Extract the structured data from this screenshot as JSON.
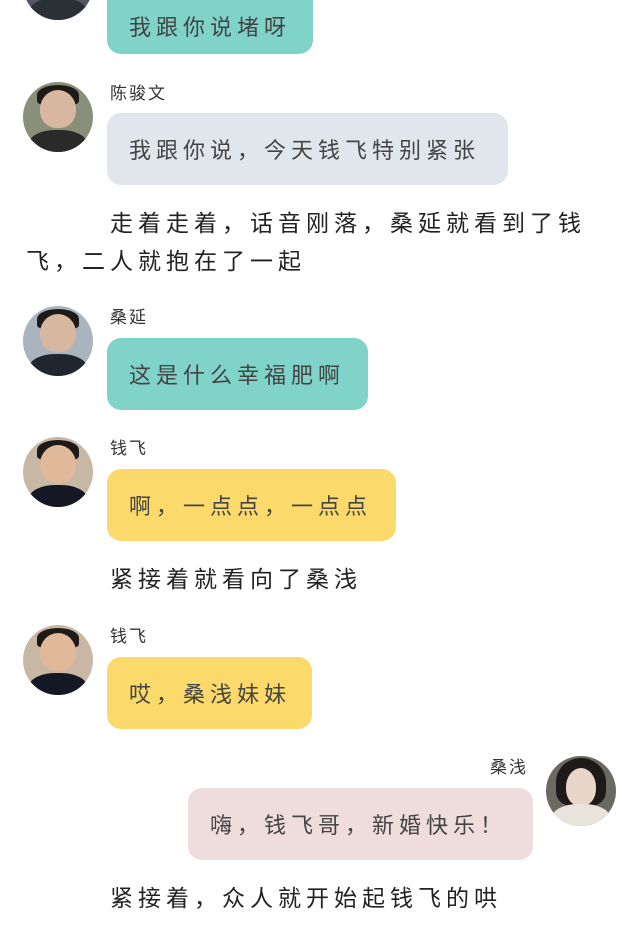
{
  "messages": [
    {
      "name": "",
      "text": "我跟你说堵呀"
    },
    {
      "name": "陈骏文",
      "text": "我跟你说，今天钱飞特别紧张"
    },
    {
      "name": "桑延",
      "text": "这是什么幸福肥啊"
    },
    {
      "name": "钱飞",
      "text": "啊，一点点，一点点"
    },
    {
      "name": "钱飞",
      "text": "哎，桑浅妹妹"
    },
    {
      "name": "桑浅",
      "text": "嗨，钱飞哥，新婚快乐！"
    }
  ],
  "narration": {
    "n1_line1": "走着走着，话音刚落，桑延就看到了钱",
    "n1_line2": "飞，二人就抱在了一起",
    "n2": "紧接着就看向了桑浅",
    "n3": "紧接着，众人就开始起钱飞的哄"
  },
  "colors": {
    "green": "#7fd3c8",
    "gray": "#e1e6ec",
    "yellow": "#fbd96a",
    "pink": "#efdcdc"
  }
}
